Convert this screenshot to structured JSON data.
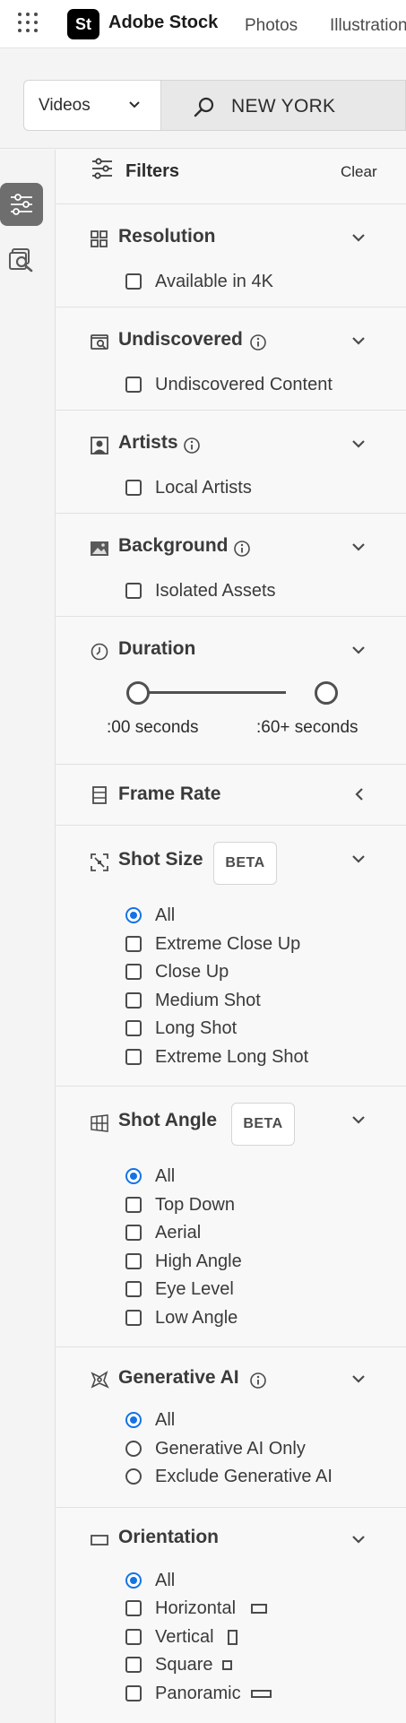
{
  "header": {
    "logo_mark": "St",
    "brand": "Adobe Stock",
    "nav": [
      "Photos",
      "Illustrations"
    ]
  },
  "search": {
    "asset_type": "Videos",
    "query": "NEW YORK"
  },
  "filters": {
    "title": "Filters",
    "clear_label": "Clear",
    "resolution": {
      "title": "Resolution",
      "option": "Available in 4K"
    },
    "undiscovered": {
      "title": "Undiscovered",
      "option": "Undiscovered Content"
    },
    "artists": {
      "title": "Artists",
      "option": "Local Artists"
    },
    "background": {
      "title": "Background",
      "option": "Isolated Assets"
    },
    "duration": {
      "title": "Duration",
      "min_label": ":00 seconds",
      "max_label": ":60+ seconds"
    },
    "frame_rate": {
      "title": "Frame Rate"
    },
    "shot_size": {
      "title": "Shot Size",
      "badge": "BETA",
      "options": [
        "All",
        "Extreme Close Up",
        "Close Up",
        "Medium Shot",
        "Long Shot",
        "Extreme Long Shot"
      ]
    },
    "shot_angle": {
      "title": "Shot Angle",
      "badge": "BETA",
      "options": [
        "All",
        "Top Down",
        "Aerial",
        "High Angle",
        "Eye Level",
        "Low Angle"
      ]
    },
    "generative_ai": {
      "title": "Generative AI",
      "options": [
        "All",
        "Generative AI Only",
        "Exclude Generative AI"
      ]
    },
    "orientation": {
      "title": "Orientation",
      "options": [
        "All",
        "Horizontal",
        "Vertical",
        "Square",
        "Panoramic"
      ]
    }
  },
  "colors": {
    "accent": "#1473e6",
    "text": "#2c2c2c",
    "rail_active": "#6e6e6e"
  }
}
